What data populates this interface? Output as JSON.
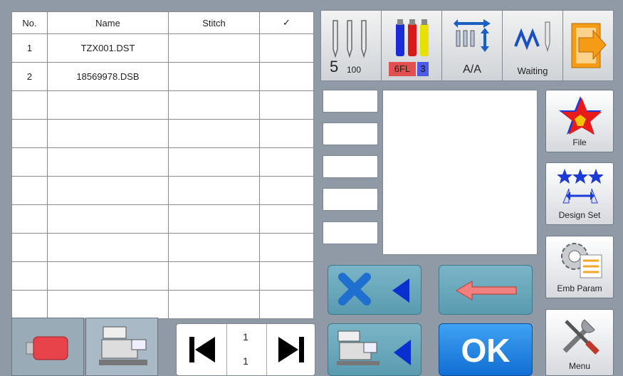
{
  "table": {
    "headers": [
      "No.",
      "Name",
      "Stitch",
      "✓"
    ],
    "rows": [
      {
        "no": "1",
        "name": "TZX001.DST",
        "stitch": "",
        "check": ""
      },
      {
        "no": "2",
        "name": "18569978.DSB",
        "stitch": "",
        "check": ""
      }
    ]
  },
  "status": {
    "needle_count": "5",
    "speed": "100",
    "color_code": "6FL",
    "color_num": "3",
    "frame_mode": "A/A",
    "machine_state": "Waiting"
  },
  "side": {
    "file_label": "File",
    "design_set_label": "Design Set",
    "emb_param_label": "Emb Param",
    "menu_label": "Menu"
  },
  "pager": {
    "current": "1",
    "total": "1"
  },
  "actions": {
    "ok_label": "OK"
  },
  "icons": [
    "needles-icon",
    "thread-spools-icon",
    "frame-adjust-icon",
    "stitch-wave-icon",
    "exit-icon",
    "star-icon",
    "design-stars-icon",
    "gear-icon",
    "tools-icon",
    "usb-drive-icon",
    "machine-icon",
    "first-page-icon",
    "last-page-icon",
    "clear-icon",
    "back-arrow-icon",
    "send-to-machine-icon"
  ]
}
